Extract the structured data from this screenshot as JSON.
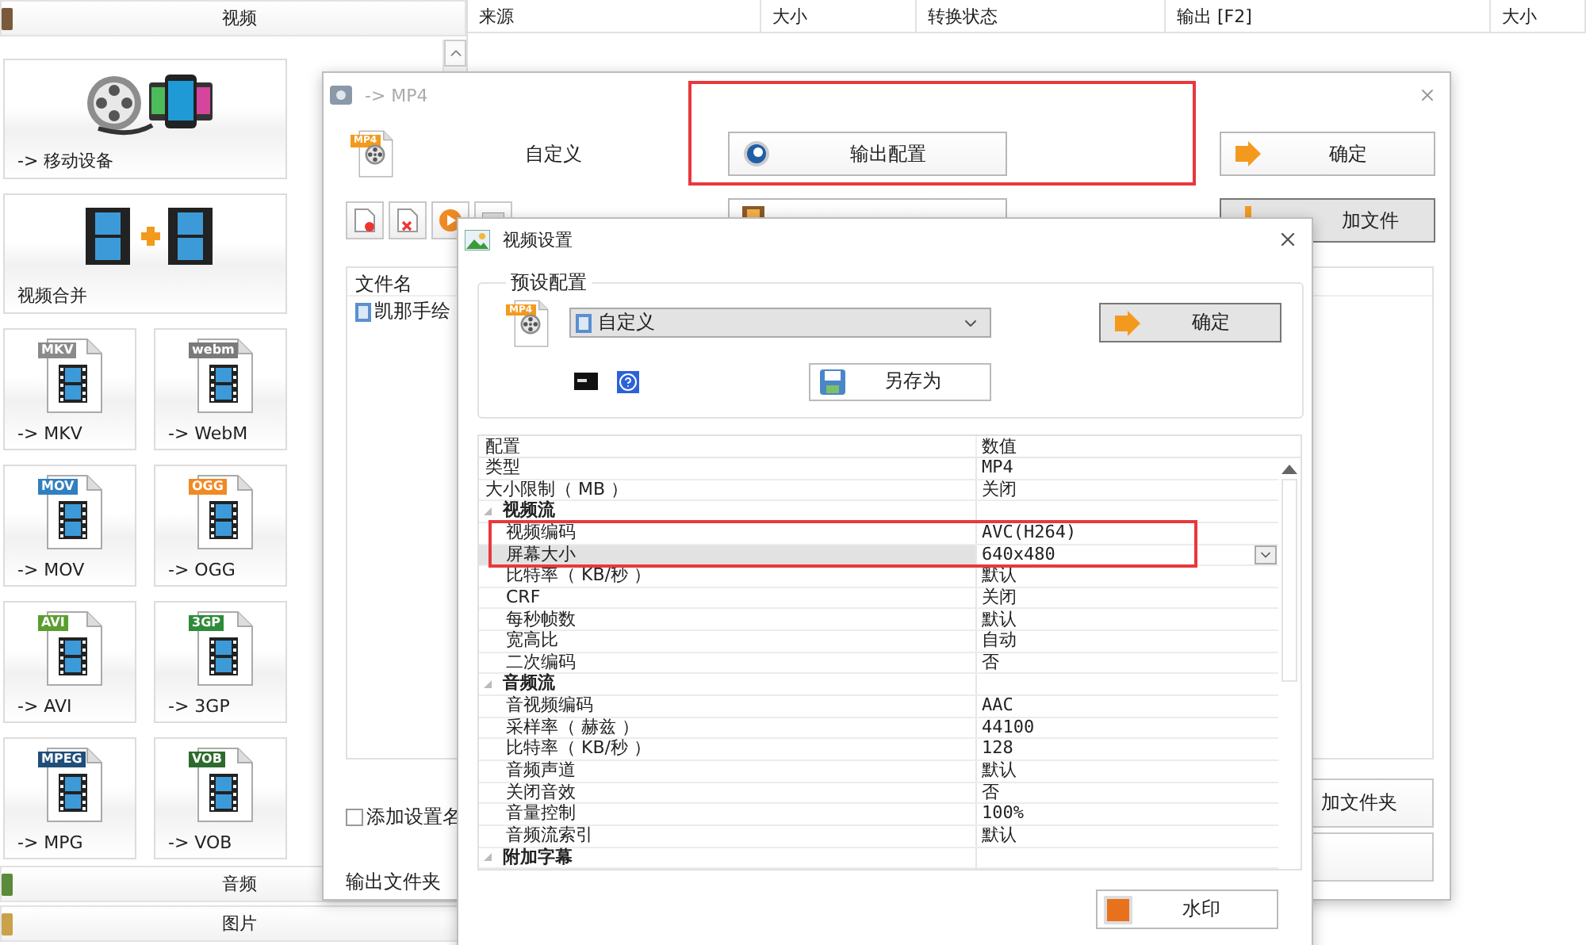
{
  "left_panel": {
    "header": "视频",
    "tiles": [
      {
        "kind": "devices",
        "label": "-> 移动设备"
      },
      {
        "kind": "merge",
        "label": "视频合并"
      },
      {
        "kind": "format",
        "label": "-> MKV",
        "badge": "MKV",
        "color": "#8a8a8a"
      },
      {
        "kind": "format",
        "label": "-> WebM",
        "badge": "webm",
        "color": "#7a7a7a"
      },
      {
        "kind": "format",
        "label": "-> MOV",
        "badge": "MOV",
        "color": "#2f7fc1"
      },
      {
        "kind": "format",
        "label": "-> OGG",
        "badge": "OGG",
        "color": "#f08a24"
      },
      {
        "kind": "format",
        "label": "-> AVI",
        "badge": "AVI",
        "color": "#5a9e2f"
      },
      {
        "kind": "format",
        "label": "-> 3GP",
        "badge": "3GP",
        "color": "#2e8b3a"
      },
      {
        "kind": "format",
        "label": "-> MPG",
        "badge": "MPEG",
        "color": "#1f4e79"
      },
      {
        "kind": "format",
        "label": "-> VOB",
        "badge": "VOB",
        "color": "#2d6a2d"
      }
    ],
    "footer_categories": [
      "音频",
      "图片"
    ]
  },
  "file_table": {
    "columns": [
      "来源",
      "大小",
      "转换状态",
      "输出 [F2]",
      "大小"
    ]
  },
  "convert_dialog": {
    "title": "-> MP4",
    "badge": "MP4",
    "preset": "自定义",
    "output_settings_button": {
      "label": "输出配置",
      "annotated": true
    },
    "ok_button": "确定",
    "add_file_button": "加文件",
    "file_list": {
      "header": "文件名",
      "rows": [
        "凯那手绘"
      ]
    },
    "add_setting_name": {
      "label": "添加设置名",
      "checked": false
    },
    "output_folder_label": "输出文件夹",
    "add_folder_button": "加文件夹"
  },
  "video_settings_dialog": {
    "title": "视频设置",
    "group_title": "预设配置",
    "badge": "MP4",
    "preset": "自定义",
    "ok_button": "确定",
    "save_as_button": "另存为",
    "watermark_button": "水印",
    "properties": {
      "columns": [
        "配置",
        "数值"
      ],
      "rows": [
        {
          "name": "类型",
          "value": "MP4",
          "selected": false
        },
        {
          "name": "大小限制（ MB ）",
          "value": "关闭",
          "selected": false
        },
        {
          "name": "视频流",
          "expanded": true,
          "selected": false,
          "children": [
            {
              "name": "视频编码",
              "value": "AVC(H264)",
              "selected": false,
              "annotated": true
            },
            {
              "name": "屏幕大小",
              "value": "640x480",
              "selected": true,
              "annotated": true
            },
            {
              "name": "比特率（ KB/秒 ）",
              "value": "默认",
              "selected": false
            },
            {
              "name": "CRF",
              "value": "关闭",
              "selected": false
            },
            {
              "name": "每秒帧数",
              "value": "默认",
              "selected": false
            },
            {
              "name": "宽高比",
              "value": "自动",
              "selected": false
            },
            {
              "name": "二次编码",
              "value": "否",
              "selected": false
            }
          ]
        },
        {
          "name": "音频流",
          "expanded": true,
          "selected": false,
          "children": [
            {
              "name": "音视频编码",
              "value": "AAC",
              "selected": false
            },
            {
              "name": "采样率（ 赫兹 ）",
              "value": "44100",
              "selected": false
            },
            {
              "name": "比特率（ KB/秒 ）",
              "value": "128",
              "selected": false
            },
            {
              "name": "音频声道",
              "value": "默认",
              "selected": false
            },
            {
              "name": "关闭音效",
              "value": "否",
              "selected": false
            },
            {
              "name": "音量控制",
              "value": "100%",
              "selected": false
            },
            {
              "name": "音频流索引",
              "value": "默认",
              "selected": false
            }
          ]
        },
        {
          "name": "附加字幕",
          "expanded": true,
          "selected": false
        }
      ]
    }
  }
}
